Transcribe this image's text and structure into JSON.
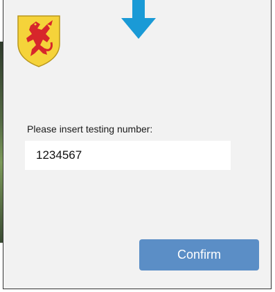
{
  "dialog": {
    "prompt_label": "Please insert testing number:",
    "testing_number_value": "1234567",
    "confirm_label": "Confirm"
  },
  "icons": {
    "top_arrow": "arrow-down-icon",
    "crest": "coat-of-arms-lion-icon"
  },
  "colors": {
    "arrow": "#1a9ad6",
    "button": "#5b8ec6",
    "crest_gold": "#f5d33a",
    "crest_red": "#d7262b",
    "dialog_bg": "#f2f2f2"
  }
}
